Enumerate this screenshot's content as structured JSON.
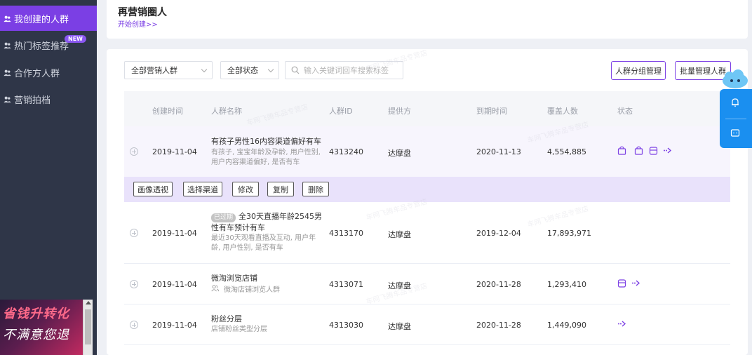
{
  "sidebar": {
    "items": [
      {
        "label": "我创建的人群",
        "icon": "group-icon",
        "active": true
      },
      {
        "label": "热门标签推荐",
        "icon": "group-icon",
        "active": false
      },
      {
        "label": "合作方人群",
        "icon": "group-icon",
        "active": false
      },
      {
        "label": "营销拍档",
        "icon": "group-icon",
        "active": false
      }
    ],
    "new_badge": "NEW",
    "promo": {
      "line1": "省钱升转化",
      "line2": "不满意您退"
    }
  },
  "header": {
    "title": "再营销圈人",
    "create_link": "开始创建>>"
  },
  "filters": {
    "type_select": "全部营销人群",
    "status_select": "全部状态",
    "search_placeholder": "输入关键词回车搜索标签"
  },
  "toolbar": {
    "group_manage": "人群分组管理",
    "batch_manage": "批量管理人群"
  },
  "table": {
    "headers": [
      "创建时间",
      "人群名称",
      "人群ID",
      "提供方",
      "到期时间",
      "覆盖人数",
      "状态"
    ],
    "actions": [
      "画像透视",
      "选择渠道",
      "修改",
      "复制",
      "删除"
    ],
    "rows": [
      {
        "created": "2019-11-04",
        "name_line1": "有孩子男性16内容渠道偏好有车",
        "name_line2": "",
        "desc_line1": "有孩子, 宝宝年龄及孕龄, 用户性别,",
        "desc_line2": "用户内容渠道偏好, 是否有车",
        "id": "4313240",
        "provider": "达摩盘",
        "expires": "2020-11-13",
        "coverage": "4,554,885"
      },
      {
        "created": "2019-11-04",
        "badge": "已过期",
        "name_line1": "全30天直播年龄2545男",
        "name_line2": "性有车预计有车",
        "desc_line1": "最近30天观看直播及互动, 用户年",
        "desc_line2": "龄, 用户性别, 是否有车",
        "id": "4313170",
        "provider": "达摩盘",
        "expires": "2019-12-04",
        "coverage": "17,893,971"
      },
      {
        "created": "2019-11-04",
        "name_line1": "微淘浏览店铺",
        "desc_line1": "微淘店铺浏览人群",
        "id": "4313071",
        "provider": "达摩盘",
        "expires": "2020-11-28",
        "coverage": "1,293,410"
      },
      {
        "created": "2019-11-04",
        "name_line1": "粉丝分层",
        "desc_line1": "店铺粉丝类型分层",
        "id": "4313030",
        "provider": "达摩盘",
        "expires": "2020-11-28",
        "coverage": "1,449,090"
      }
    ]
  },
  "watermark": "车网飞腾车品专营店",
  "colors": {
    "accent": "#7b3fe4",
    "sidebar": "#2f3648",
    "float": "#1a8ff0"
  }
}
